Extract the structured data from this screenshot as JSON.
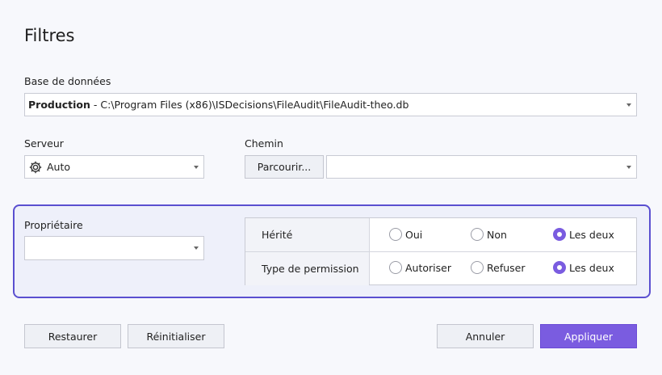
{
  "title": "Filtres",
  "database": {
    "label": "Base de données",
    "bold": "Production",
    "path": " - C:\\Program Files (x86)\\ISDecisions\\FileAudit\\FileAudit-theo.db"
  },
  "server": {
    "label": "Serveur",
    "value": "Auto",
    "icon": "gear-icon"
  },
  "path": {
    "label": "Chemin",
    "browse_label": "Parcourir...",
    "value": ""
  },
  "owner": {
    "label": "Propriétaire",
    "value": ""
  },
  "filters": {
    "rows": [
      {
        "label": "Hérité",
        "options": [
          "Oui",
          "Non",
          "Les deux"
        ],
        "selected": "Les deux"
      },
      {
        "label": "Type de permission",
        "options": [
          "Autoriser",
          "Refuser",
          "Les deux"
        ],
        "selected": "Les deux"
      }
    ]
  },
  "buttons": {
    "restore": "Restaurer",
    "reset": "Réinitialiser",
    "cancel": "Annuler",
    "apply": "Appliquer"
  },
  "colors": {
    "accent": "#7a5ce0",
    "panel_border": "#5a4fd0",
    "panel_bg": "#eef0fa"
  }
}
